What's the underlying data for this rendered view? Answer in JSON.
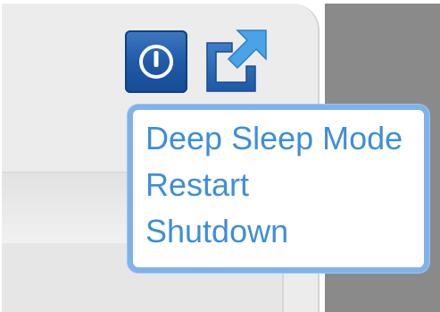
{
  "toolbar": {
    "power_button_icon": "power-icon",
    "popout_button_icon": "popout-icon"
  },
  "power_menu": {
    "items": [
      {
        "label": "Deep Sleep Mode"
      },
      {
        "label": "Restart"
      },
      {
        "label": "Shutdown"
      }
    ]
  },
  "colors": {
    "accent_blue": "#1f5aa8",
    "menu_text": "#3e8ed8",
    "menu_border": "#7fb2ea",
    "panel_bg": "#ececec",
    "side_gray": "#8a8a8a"
  }
}
